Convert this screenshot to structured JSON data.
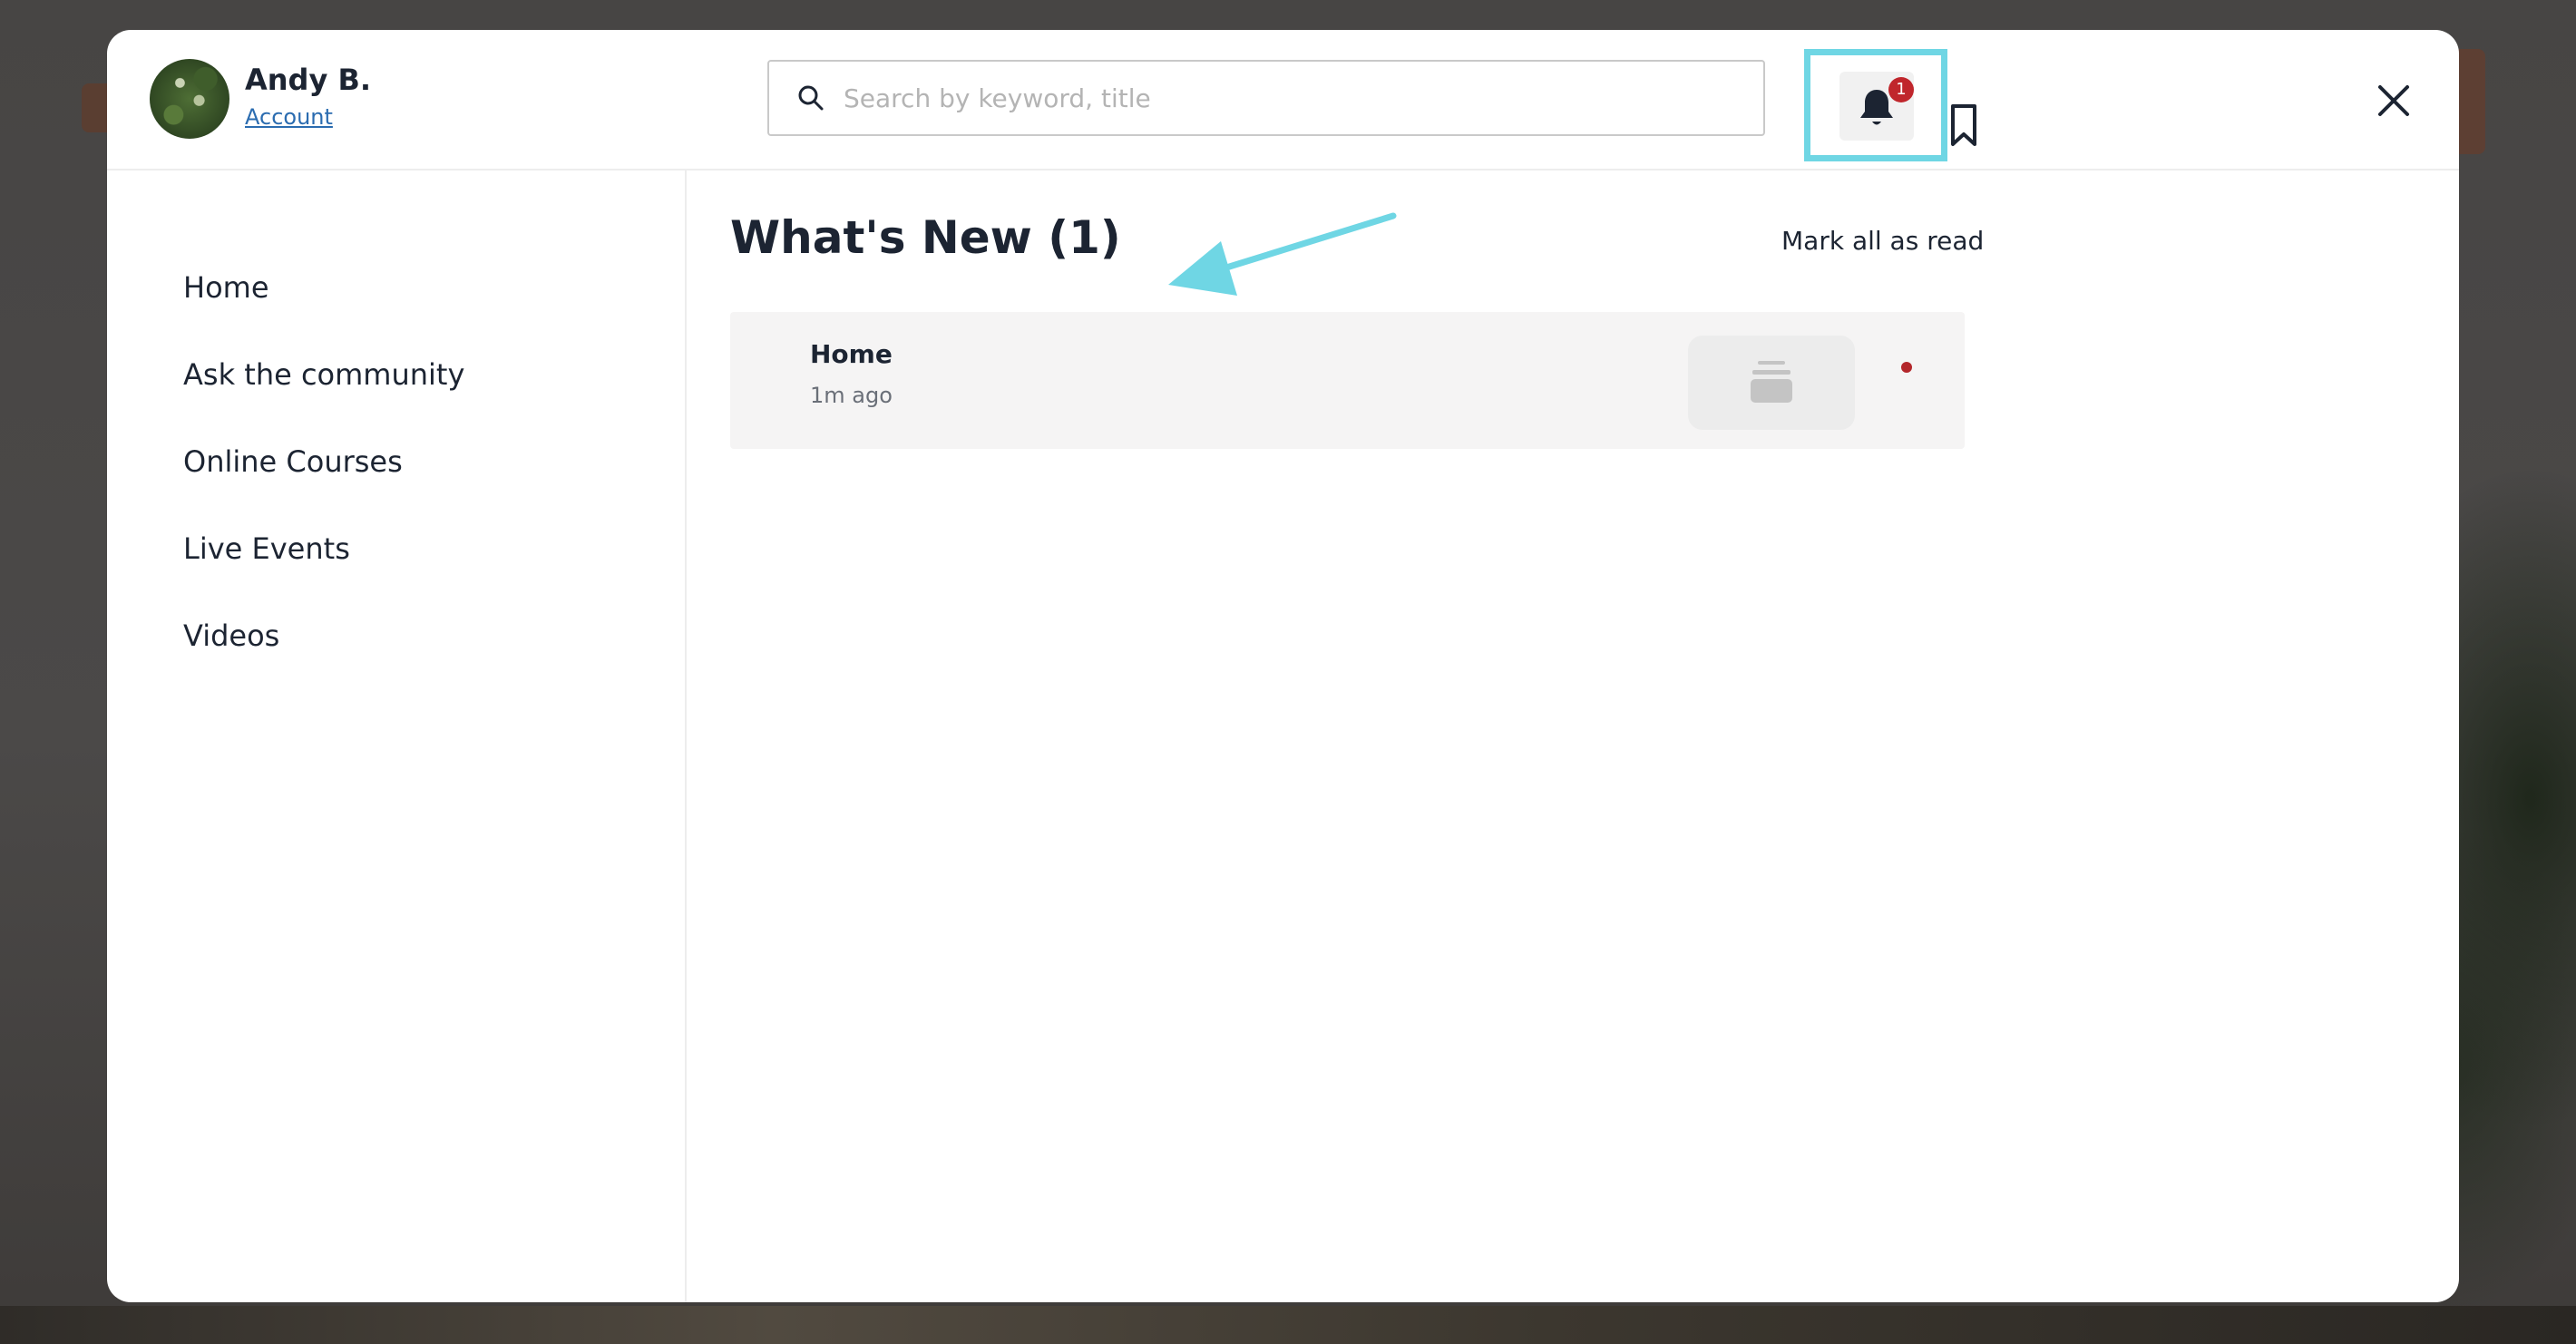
{
  "user": {
    "name": "Andy B.",
    "account_label": "Account"
  },
  "search": {
    "placeholder": "Search by keyword, title",
    "value": ""
  },
  "notifications": {
    "badge_count": "1"
  },
  "sidebar": {
    "items": [
      {
        "label": "Home"
      },
      {
        "label": "Ask the community"
      },
      {
        "label": "Online Courses"
      },
      {
        "label": "Live Events"
      },
      {
        "label": "Videos"
      }
    ]
  },
  "main": {
    "title": "What's New (1)",
    "mark_all_label": "Mark all as read",
    "items": [
      {
        "title": "Home",
        "time": "1m ago",
        "unread": true
      }
    ]
  },
  "colors": {
    "highlight": "#6fd6e4",
    "badge": "#c0262c",
    "unread_dot": "#b3262a",
    "link": "#2b6cb0"
  },
  "icons": {
    "search": "search-icon",
    "bell": "bell-icon",
    "bookmark": "bookmark-icon",
    "close": "close-icon",
    "thumbnail": "stack-icon"
  }
}
